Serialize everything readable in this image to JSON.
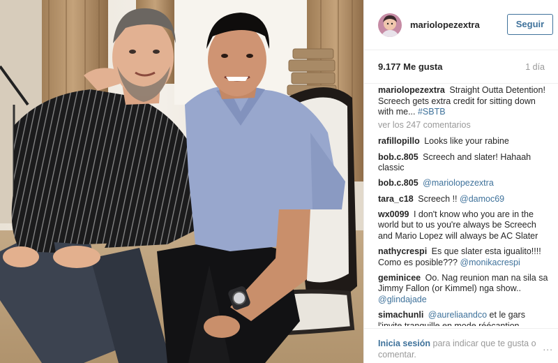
{
  "post": {
    "username": "mariolopezextra",
    "follow_label": "Seguir",
    "likes": "9.177 Me gusta",
    "time_ago": "1 día",
    "caption_user": "mariolopezextra",
    "caption_text": "Straight Outta Detention! Screech gets extra credit for sitting down with me...",
    "caption_hashtag": "#SBTB",
    "view_all": "ver los 247 comentarios"
  },
  "comments": [
    {
      "user": "rafillopillo",
      "text": "Looks like your rabine",
      "mention": ""
    },
    {
      "user": "bob.c.805",
      "text": "Screech and slater! Hahaah classic",
      "mention": ""
    },
    {
      "user": "bob.c.805",
      "text": "",
      "mention": "@mariolopezextra"
    },
    {
      "user": "tara_c18",
      "text": "Screech !!",
      "mention": "@damoc69"
    },
    {
      "user": "wx0099",
      "text": "I don't know who you are in the world but to us you're always be Screech and Mario Lopez will always be AC Slater",
      "mention": ""
    },
    {
      "user": "nathycrespi",
      "text": "Es que slater esta igualito!!!! Como es posible???",
      "mention": "@monikacrespi"
    },
    {
      "user": "geminicee",
      "text": "Oo. Nag reunion man na sila sa Jimmy Fallon (or Kimmel) nga show..",
      "mention": "@glindajade"
    },
    {
      "user": "simachunli",
      "text_before": "",
      "mention": "@aureliaandco",
      "text": "et le gars l'invite tranquille en mode réécantion"
    }
  ],
  "footer": {
    "login_label": "Inicia sesión",
    "login_text": "para indicar que te gusta o comentar.",
    "more_label": "..."
  }
}
